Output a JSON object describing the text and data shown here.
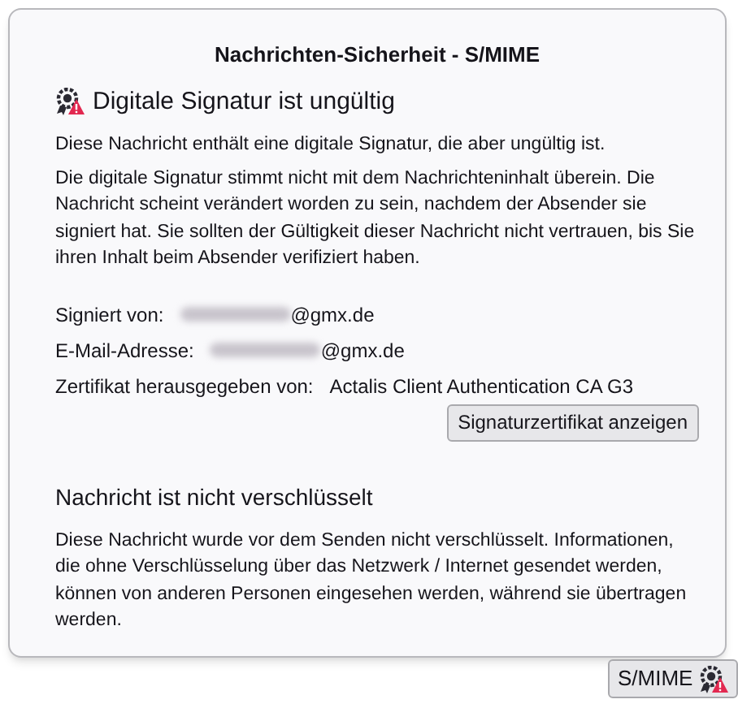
{
  "popup": {
    "title": "Nachrichten-Sicherheit - S/MIME",
    "signature": {
      "valid": false,
      "heading": "Digitale Signatur ist ungültig",
      "paragraphs": [
        "Diese Nachricht enthält eine digitale Signatur, die aber ungültig ist.",
        "Die digitale Signatur stimmt nicht mit dem Nachrichteninhalt überein. Die Nachricht scheint verändert worden zu sein, nachdem der Absender sie signiert hat. Sie sollten der Gültigkeit dieser Nachricht nicht vertrauen, bis Sie ihren Inhalt beim Absender verifiziert haben."
      ],
      "fields": [
        {
          "label": "Signiert von:",
          "value": "@gmx.de",
          "redacted": true
        },
        {
          "label": "E-Mail-Adresse:",
          "value": "@gmx.de",
          "redacted": true
        },
        {
          "label": "Zertifikat herausgegeben von:",
          "value": "Actalis Client Authentication CA G3",
          "redacted": false
        }
      ],
      "button": "Signaturzertifikat anzeigen"
    },
    "encryption": {
      "heading": "Nachricht ist nicht verschlüsselt",
      "paragraph": "Diese Nachricht wurde vor dem Senden nicht verschlüsselt. Informationen, die ohne Verschlüsselung über das Netzwerk / Internet gesendet werden, können von anderen Personen eingesehen werden, während sie übertragen werden."
    }
  },
  "status_button": {
    "label": "S/MIME"
  }
}
